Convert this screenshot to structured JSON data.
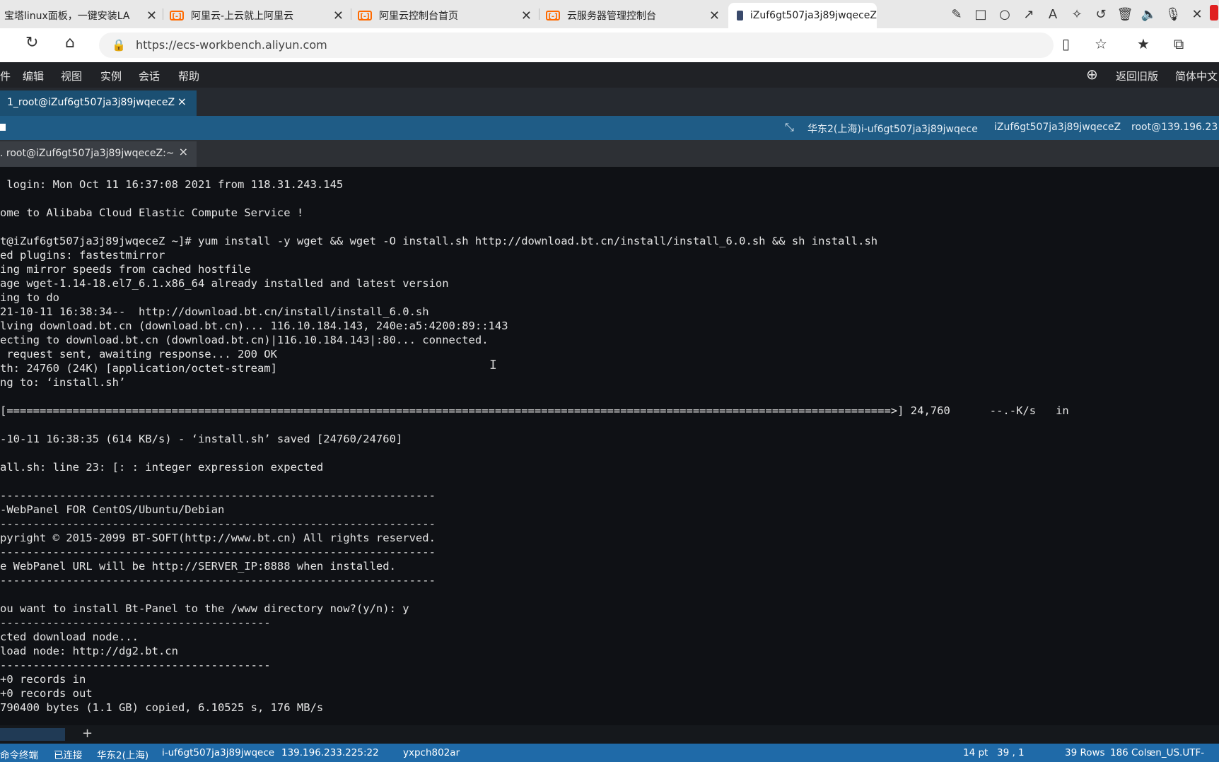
{
  "browser": {
    "tabs": [
      {
        "title": "宝塔linux面板，一键安装LA"
      },
      {
        "title": "阿里云-上云就上阿里云"
      },
      {
        "title": "阿里云控制台首页"
      },
      {
        "title": "云服务器管理控制台"
      },
      {
        "title": "iZuf6gt507ja3j89jwqeceZ"
      }
    ],
    "close_glyph": "✕",
    "url": "https://ecs-workbench.aliyun.com",
    "favicon_text": "[-]"
  },
  "menu": {
    "items": [
      "件",
      "编辑",
      "视图",
      "实例",
      "会话",
      "帮助"
    ],
    "right": [
      "返回旧版",
      "简体中文"
    ]
  },
  "session_tab": {
    "title": "1_root@iZuf6gt507ja3j89jwqeceZ",
    "close": "×"
  },
  "info": {
    "items": [
      "华东2(上海)i-uf6gt507ja3j89jwqece",
      "iZuf6gt507ja3j89jwqeceZ",
      "root@139.196.23"
    ]
  },
  "terminal_tab": {
    "title": ". root@iZuf6gt507ja3j89jwqeceZ:~",
    "close": "×"
  },
  "terminal": {
    "lines": [
      " login: Mon Oct 11 16:37:08 2021 from 118.31.243.145",
      "",
      "ome to Alibaba Cloud Elastic Compute Service !",
      "",
      "t@iZuf6gt507ja3j89jwqeceZ ~]# yum install -y wget && wget -O install.sh http://download.bt.cn/install/install_6.0.sh && sh install.sh",
      "ed plugins: fastestmirror",
      "ing mirror speeds from cached hostfile",
      "age wget-1.14-18.el7_6.1.x86_64 already installed and latest version",
      "ing to do",
      "21-10-11 16:38:34--  http://download.bt.cn/install/install_6.0.sh",
      "lving download.bt.cn (download.bt.cn)... 116.10.184.143, 240e:a5:4200:89::143",
      "ecting to download.bt.cn (download.bt.cn)|116.10.184.143|:80... connected.",
      " request sent, awaiting response... 200 OK",
      "th: 24760 (24K) [application/octet-stream]",
      "ng to: ‘install.sh’",
      "",
      "[======================================================================================================================================>] 24,760      --.-K/s   in",
      "",
      "-10-11 16:38:35 (614 KB/s) - ‘install.sh’ saved [24760/24760]",
      "",
      "all.sh: line 23: [: : integer expression expected",
      "",
      "------------------------------------------------------------------",
      "-WebPanel FOR CentOS/Ubuntu/Debian",
      "------------------------------------------------------------------",
      "pyright © 2015-2099 BT-SOFT(http://www.bt.cn) All rights reserved.",
      "------------------------------------------------------------------",
      "e WebPanel URL will be http://SERVER_IP:8888 when installed.",
      "------------------------------------------------------------------",
      "",
      "ou want to install Bt-Panel to the /www directory now?(y/n): y",
      "-----------------------------------------",
      "cted download node...",
      "load node: http://dg2.bt.cn",
      "-----------------------------------------",
      "+0 records in",
      "+0 records out",
      "790400 bytes (1.1 GB) copied, 6.10525 s, 176 MB/s"
    ]
  },
  "bottom": {
    "plus": "+"
  },
  "status": {
    "left": [
      "命令终端",
      "已连接",
      "华东2(上海)",
      "i-uf6gt507ja3j89jwqece",
      "139.196.233.225:22",
      "yxpch802ar"
    ],
    "right": [
      "14 pt",
      "39 , 1",
      "39 Rows",
      "186 Cols",
      "en_US.UTF-"
    ]
  },
  "icons": [
    "pen-icon",
    "square-icon",
    "circle-icon",
    "arrow-icon",
    "text-icon",
    "magic-wand-icon",
    "undo-icon",
    "trash-icon",
    "speaker-icon",
    "mic-icon",
    "close-icon",
    "refresh-icon",
    "home-icon",
    "lock-icon",
    "reading-list-icon",
    "favorite-add-icon",
    "favorites-icon",
    "collections-icon",
    "add-circle-icon"
  ]
}
